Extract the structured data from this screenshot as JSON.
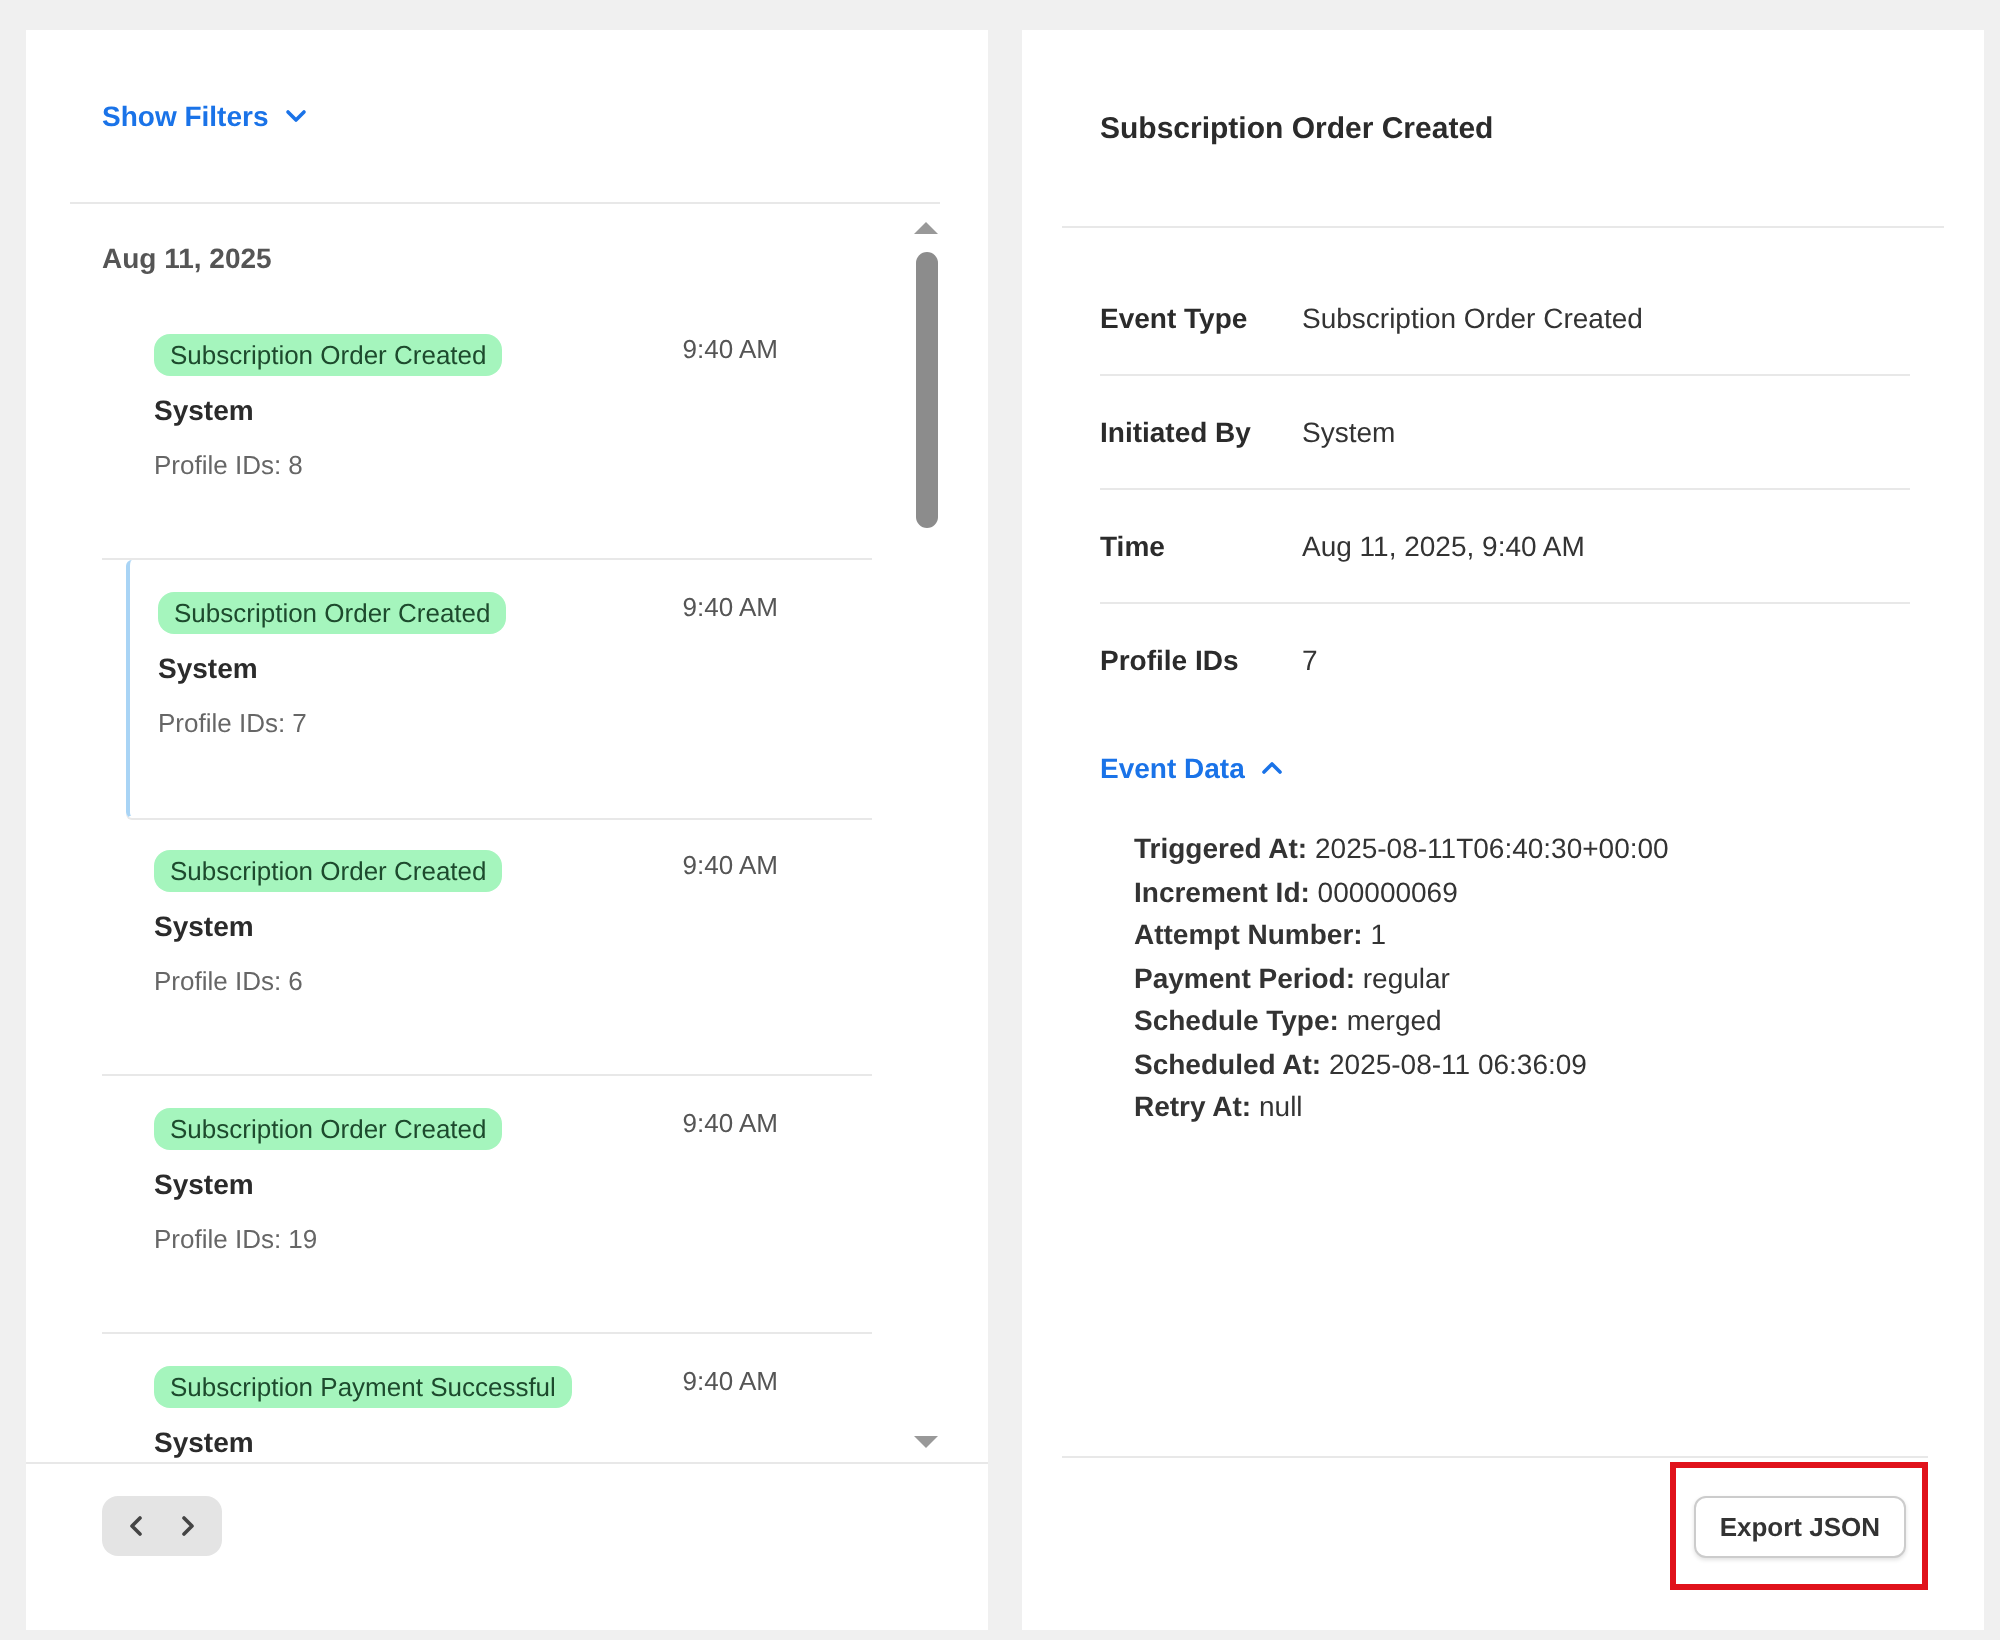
{
  "filters_toggle": {
    "label": "Show Filters",
    "expanded": false
  },
  "event_list": {
    "date": "Aug 11, 2025",
    "items": [
      {
        "badge": "Subscription Order Created",
        "time": "9:40 AM",
        "actor": "System",
        "profile_ids": "Profile IDs: 8",
        "selected": false
      },
      {
        "badge": "Subscription Order Created",
        "time": "9:40 AM",
        "actor": "System",
        "profile_ids": "Profile IDs: 7",
        "selected": true
      },
      {
        "badge": "Subscription Order Created",
        "time": "9:40 AM",
        "actor": "System",
        "profile_ids": "Profile IDs: 6",
        "selected": false
      },
      {
        "badge": "Subscription Order Created",
        "time": "9:40 AM",
        "actor": "System",
        "profile_ids": "Profile IDs: 19",
        "selected": false
      },
      {
        "badge": "Subscription Payment Successful",
        "time": "9:40 AM",
        "actor": "System",
        "selected": false
      }
    ]
  },
  "pagination": {
    "previous_disabled": false,
    "next_disabled": false
  },
  "detail": {
    "title": "Subscription Order Created",
    "fields": [
      {
        "label": "Event Type",
        "value": "Subscription Order Created"
      },
      {
        "label": "Initiated By",
        "value": "System"
      },
      {
        "label": "Time",
        "value": "Aug 11, 2025, 9:40 AM"
      },
      {
        "label": "Profile IDs",
        "value": "7"
      }
    ],
    "event_data_toggle": {
      "label": "Event Data",
      "expanded": true
    },
    "event_data": [
      "**Triggered At:** 2025-08-11T06:40:30+00:00",
      "**Increment Id:** 000000069",
      "**Attempt Number:** 1",
      "**Payment Period:** regular",
      "**Schedule Type:** merged",
      "**Scheduled At:** 2025-08-11 06:36:09",
      "**Retry At:** null"
    ],
    "export_button": {
      "label": "Export JSON",
      "highlighted": true
    }
  }
}
